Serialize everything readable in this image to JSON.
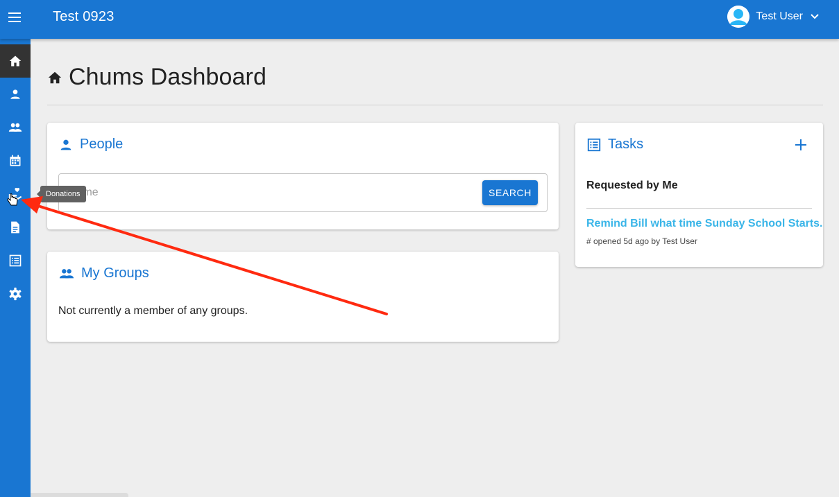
{
  "topbar": {
    "app_title": "Test 0923",
    "user_name": "Test User",
    "icons": [
      "menu-icon",
      "user-avatar-icon",
      "chevron-down-icon"
    ]
  },
  "sidebar": {
    "items": [
      {
        "id": "home",
        "icon": "home-icon",
        "active": true
      },
      {
        "id": "people",
        "icon": "person-icon"
      },
      {
        "id": "groups",
        "icon": "groups-icon"
      },
      {
        "id": "attendance",
        "icon": "calendar-icon"
      },
      {
        "id": "donations",
        "icon": "donations-icon"
      },
      {
        "id": "forms",
        "icon": "document-icon"
      },
      {
        "id": "tasks",
        "icon": "list-icon"
      },
      {
        "id": "settings",
        "icon": "gear-icon"
      }
    ],
    "tooltip": "Donations"
  },
  "page": {
    "title": "Chums Dashboard"
  },
  "people_card": {
    "title": "People",
    "search_placeholder": "Name",
    "search_button": "SEARCH"
  },
  "groups_card": {
    "title": "My Groups",
    "empty_text": "Not currently a member of any groups."
  },
  "tasks_card": {
    "title": "Tasks",
    "section_title": "Requested by Me",
    "task_title": "Remind Bill what time Sunday School Starts.",
    "task_meta": "# opened 5d ago by Test User"
  },
  "colors": {
    "primary": "#1976d2",
    "link": "#3ab5e8",
    "active_nav": "#333333",
    "annotation_arrow": "#ff2a10"
  }
}
